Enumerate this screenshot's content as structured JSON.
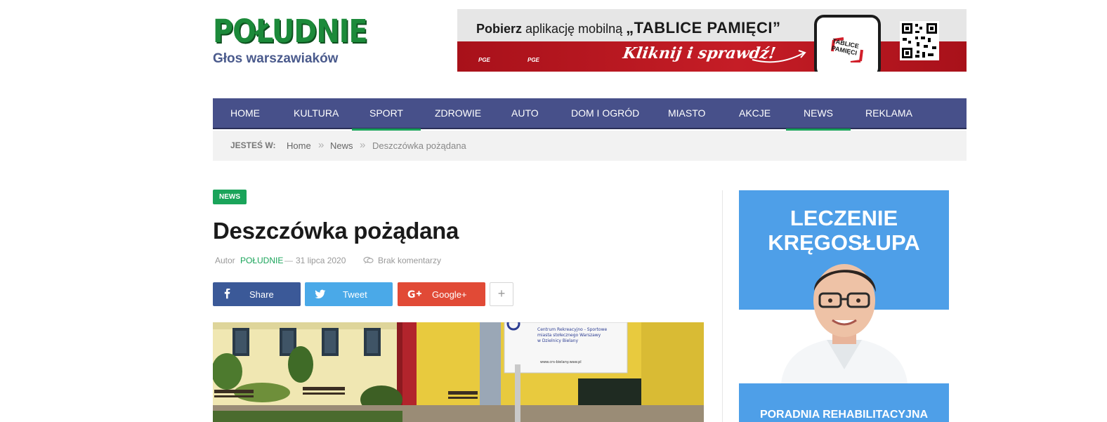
{
  "logo": {
    "title": "POŁUDNIE",
    "subtitle": "Głos warszawiaków"
  },
  "banner": {
    "text_bold": "Pobierz",
    "text_regular": " aplikację mobilną ",
    "app_name": "„TABLICE PAMIĘCI”",
    "cta": "Kliknij i sprawdź!",
    "sponsor_1": "PGE",
    "sponsor_2": "PGE",
    "phone_label": "TABLICE PAMIĘCI"
  },
  "nav": {
    "items": [
      {
        "label": "HOME",
        "active": false
      },
      {
        "label": "KULTURA",
        "active": false
      },
      {
        "label": "SPORT",
        "active": true
      },
      {
        "label": "ZDROWIE",
        "active": false
      },
      {
        "label": "AUTO",
        "active": false
      },
      {
        "label": "DOM I OGRÓD",
        "active": false
      },
      {
        "label": "MIASTO",
        "active": false
      },
      {
        "label": "AKCJE",
        "active": false
      },
      {
        "label": "NEWS",
        "active": true
      },
      {
        "label": "REKLAMA",
        "active": false
      }
    ]
  },
  "breadcrumb": {
    "label": "JESTEŚ W:",
    "items": [
      "Home",
      "News",
      "Deszczówka pożądana"
    ],
    "separator": "»"
  },
  "article": {
    "category": "NEWS",
    "title": "Deszczówka pożądana",
    "author_prefix": "Autor",
    "author": "POŁUDNIE",
    "dash": "—",
    "date": "31 lipca 2020",
    "comments": "Brak komentarzy"
  },
  "share": {
    "facebook": "Share",
    "twitter": "Tweet",
    "google": "Google+",
    "more": "+"
  },
  "photo": {
    "sign_text": "Centrum Rekreacyjno - Sportowe miasta stołecznego Warszawy w Dzielnicy Bielany",
    "sign_url": "www.crs-bielany.waw.pl"
  },
  "sidebar_ad": {
    "headline_1": "LECZENIE",
    "headline_2": "KRĘGOSŁUPA",
    "subline": "PORADNIA REHABILITACYJNA"
  },
  "colors": {
    "nav_bg": "#47508a",
    "accent_green": "#1aa45a",
    "facebook": "#3b5998",
    "twitter": "#4aa9e8",
    "google": "#e14a36",
    "ad_blue": "#4e9fe8",
    "banner_red": "#c51d26"
  },
  "icons": {
    "facebook": "facebook-icon",
    "twitter": "twitter-icon",
    "google": "google-plus-icon",
    "comments": "comment-icon",
    "qr": "qr-code-icon"
  }
}
